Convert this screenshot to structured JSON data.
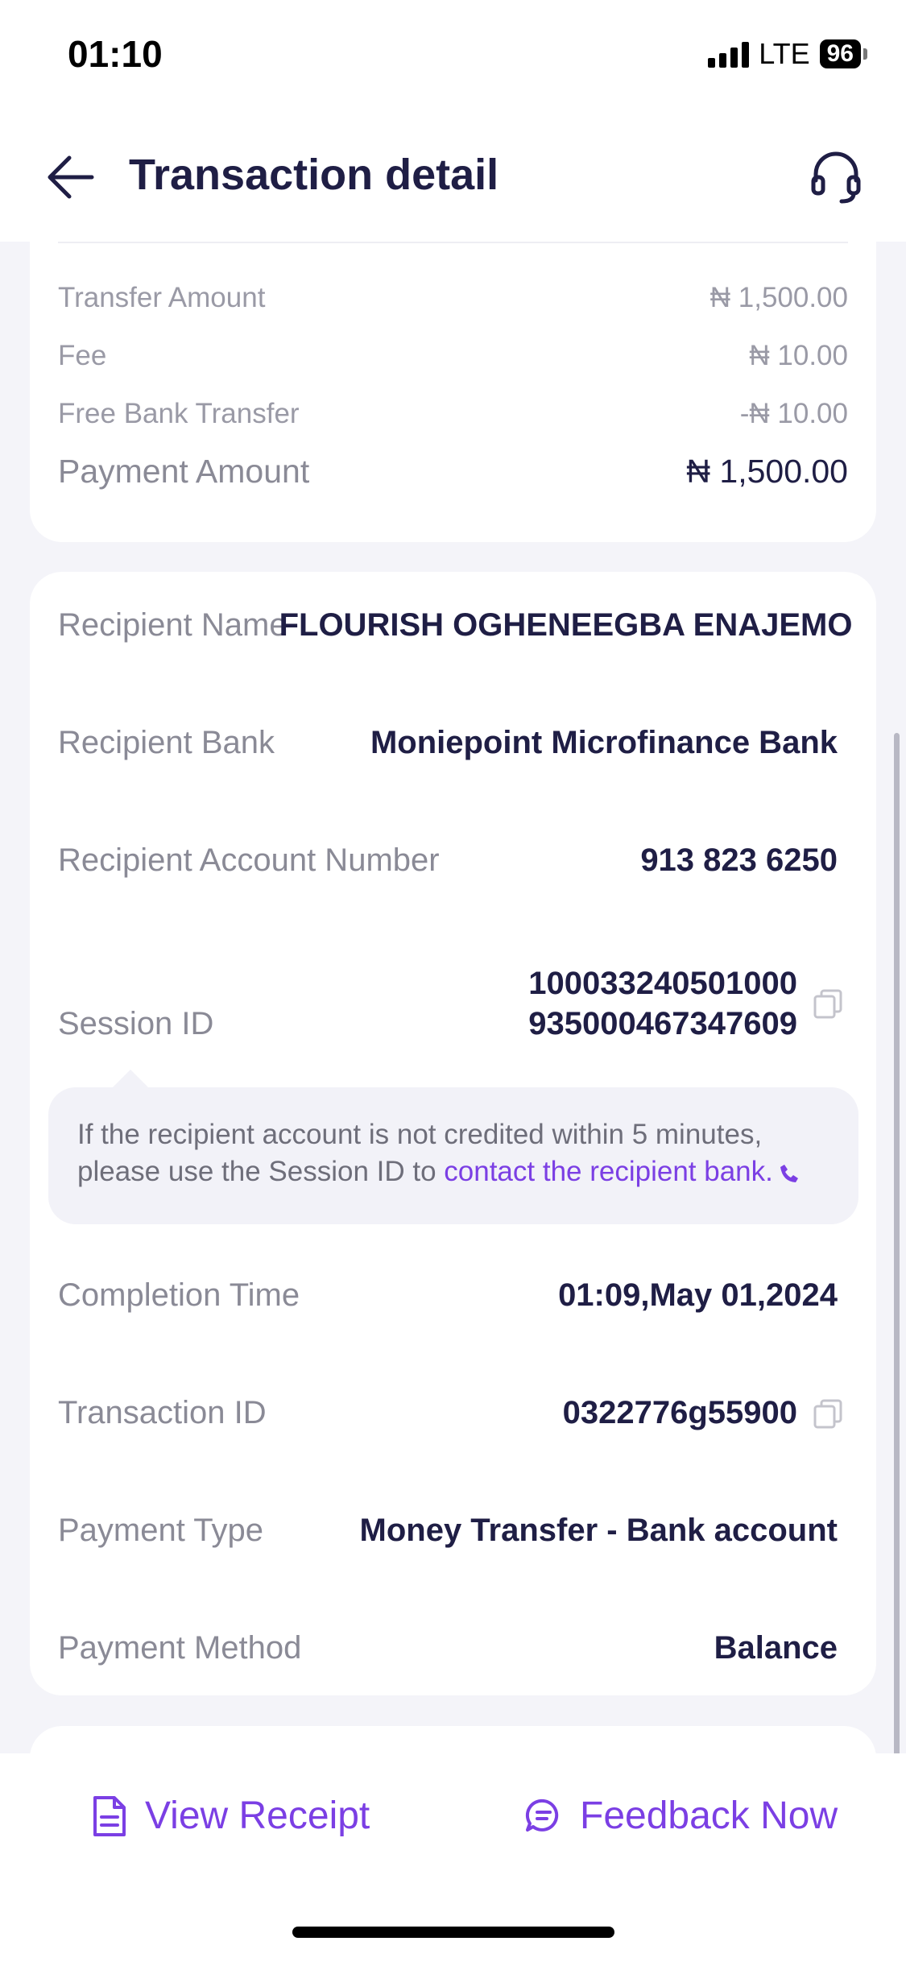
{
  "status_bar": {
    "time": "01:10",
    "network": "LTE",
    "battery": "96"
  },
  "header": {
    "title": "Transaction detail",
    "back_icon": "arrow-left-icon",
    "support_icon": "headset-icon"
  },
  "amounts": {
    "transfer_amount": {
      "label": "Transfer Amount",
      "value": "₦ 1,500.00"
    },
    "fee": {
      "label": "Fee",
      "value": "₦ 10.00"
    },
    "free_bank_transfer": {
      "label": "Free Bank Transfer",
      "value": "-₦ 10.00"
    },
    "payment_amount": {
      "label": "Payment Amount",
      "value": "₦ 1,500.00"
    }
  },
  "details": {
    "recipient_name": {
      "label": "Recipient Name",
      "value": "FLOURISH OGHENEEGBA ENAJEMO"
    },
    "recipient_bank": {
      "label": "Recipient Bank",
      "value": "Moniepoint Microfinance Bank"
    },
    "recipient_account": {
      "label": "Recipient Account Number",
      "value": "913 823 6250"
    },
    "session_id": {
      "label": "Session ID",
      "value_line1": "100033240501000",
      "value_line2": "935000467347609"
    },
    "notice": {
      "text": "If the recipient account is not credited within 5 minutes, please use the Session ID to ",
      "link": "contact the recipient bank."
    },
    "completion_time": {
      "label": "Completion Time",
      "value": "01:09,May 01,2024"
    },
    "transaction_id": {
      "label": "Transaction ID",
      "value": "0322776g55900"
    },
    "payment_type": {
      "label": "Payment Type",
      "value": "Money Transfer - Bank account"
    },
    "payment_method": {
      "label": "Payment Method",
      "value": "Balance"
    }
  },
  "actions": {
    "view_receipt": "View Receipt",
    "feedback_now": "Feedback Now"
  },
  "colors": {
    "accent": "#7b3fe4",
    "text_dark": "#1f1e45",
    "text_muted": "#8a8a96",
    "background": "#f4f4f9"
  }
}
